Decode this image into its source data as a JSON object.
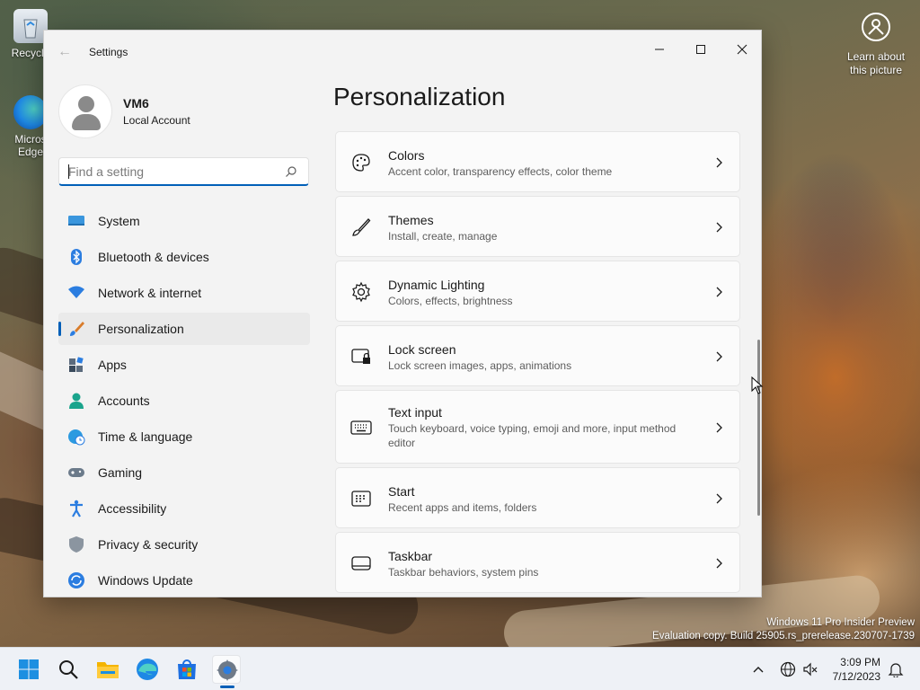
{
  "desktop": {
    "icons": [
      {
        "label": "Recycle",
        "icon": "recycle-bin-icon"
      },
      {
        "label": "Micros\nEdge",
        "icon": "edge-icon"
      }
    ],
    "learn_about_picture": "Learn about this picture",
    "watermark_line1": "Windows 11 Pro Insider Preview",
    "watermark_line2": "Evaluation copy. Build 25905.rs_prerelease.230707-1739"
  },
  "window": {
    "title": "Settings",
    "controls": {
      "minimize": "—",
      "maximize": "☐",
      "close": "✕"
    },
    "back_icon": "back-arrow-icon"
  },
  "profile": {
    "name": "VM6",
    "account_type": "Local Account"
  },
  "search": {
    "placeholder": "Find a setting",
    "value": ""
  },
  "nav": {
    "items": [
      {
        "label": "System",
        "icon": "system-icon"
      },
      {
        "label": "Bluetooth & devices",
        "icon": "bluetooth-icon"
      },
      {
        "label": "Network & internet",
        "icon": "wifi-icon"
      },
      {
        "label": "Personalization",
        "icon": "brush-icon",
        "active": true
      },
      {
        "label": "Apps",
        "icon": "apps-icon"
      },
      {
        "label": "Accounts",
        "icon": "accounts-icon"
      },
      {
        "label": "Time & language",
        "icon": "time-language-icon"
      },
      {
        "label": "Gaming",
        "icon": "gamepad-icon"
      },
      {
        "label": "Accessibility",
        "icon": "accessibility-icon"
      },
      {
        "label": "Privacy & security",
        "icon": "shield-icon"
      },
      {
        "label": "Windows Update",
        "icon": "update-icon"
      }
    ]
  },
  "page": {
    "title": "Personalization",
    "cards": [
      {
        "title": "Colors",
        "subtitle": "Accent color, transparency effects, color theme",
        "icon": "palette-icon"
      },
      {
        "title": "Themes",
        "subtitle": "Install, create, manage",
        "icon": "brush-icon"
      },
      {
        "title": "Dynamic Lighting",
        "subtitle": "Colors, effects, brightness",
        "icon": "gear-icon"
      },
      {
        "title": "Lock screen",
        "subtitle": "Lock screen images, apps, animations",
        "icon": "lock-screen-icon"
      },
      {
        "title": "Text input",
        "subtitle": "Touch keyboard, voice typing, emoji and more, input method editor",
        "icon": "keyboard-icon"
      },
      {
        "title": "Start",
        "subtitle": "Recent apps and items, folders",
        "icon": "start-icon"
      },
      {
        "title": "Taskbar",
        "subtitle": "Taskbar behaviors, system pins",
        "icon": "taskbar-icon"
      }
    ]
  },
  "taskbar": {
    "apps": [
      {
        "name": "Start",
        "icon": "windows-start-icon"
      },
      {
        "name": "Search",
        "icon": "search-icon"
      },
      {
        "name": "File Explorer",
        "icon": "folder-icon"
      },
      {
        "name": "Microsoft Edge",
        "icon": "edge-icon"
      },
      {
        "name": "Microsoft Store",
        "icon": "store-icon"
      },
      {
        "name": "Settings",
        "icon": "settings-gear-icon",
        "active": true
      }
    ],
    "time": "3:09 PM",
    "date": "7/12/2023"
  },
  "colors": {
    "accent": "#005fb8",
    "window_bg": "#f3f3f3",
    "card_bg": "#fbfbfb",
    "taskbar_bg": "#eef1f6"
  }
}
